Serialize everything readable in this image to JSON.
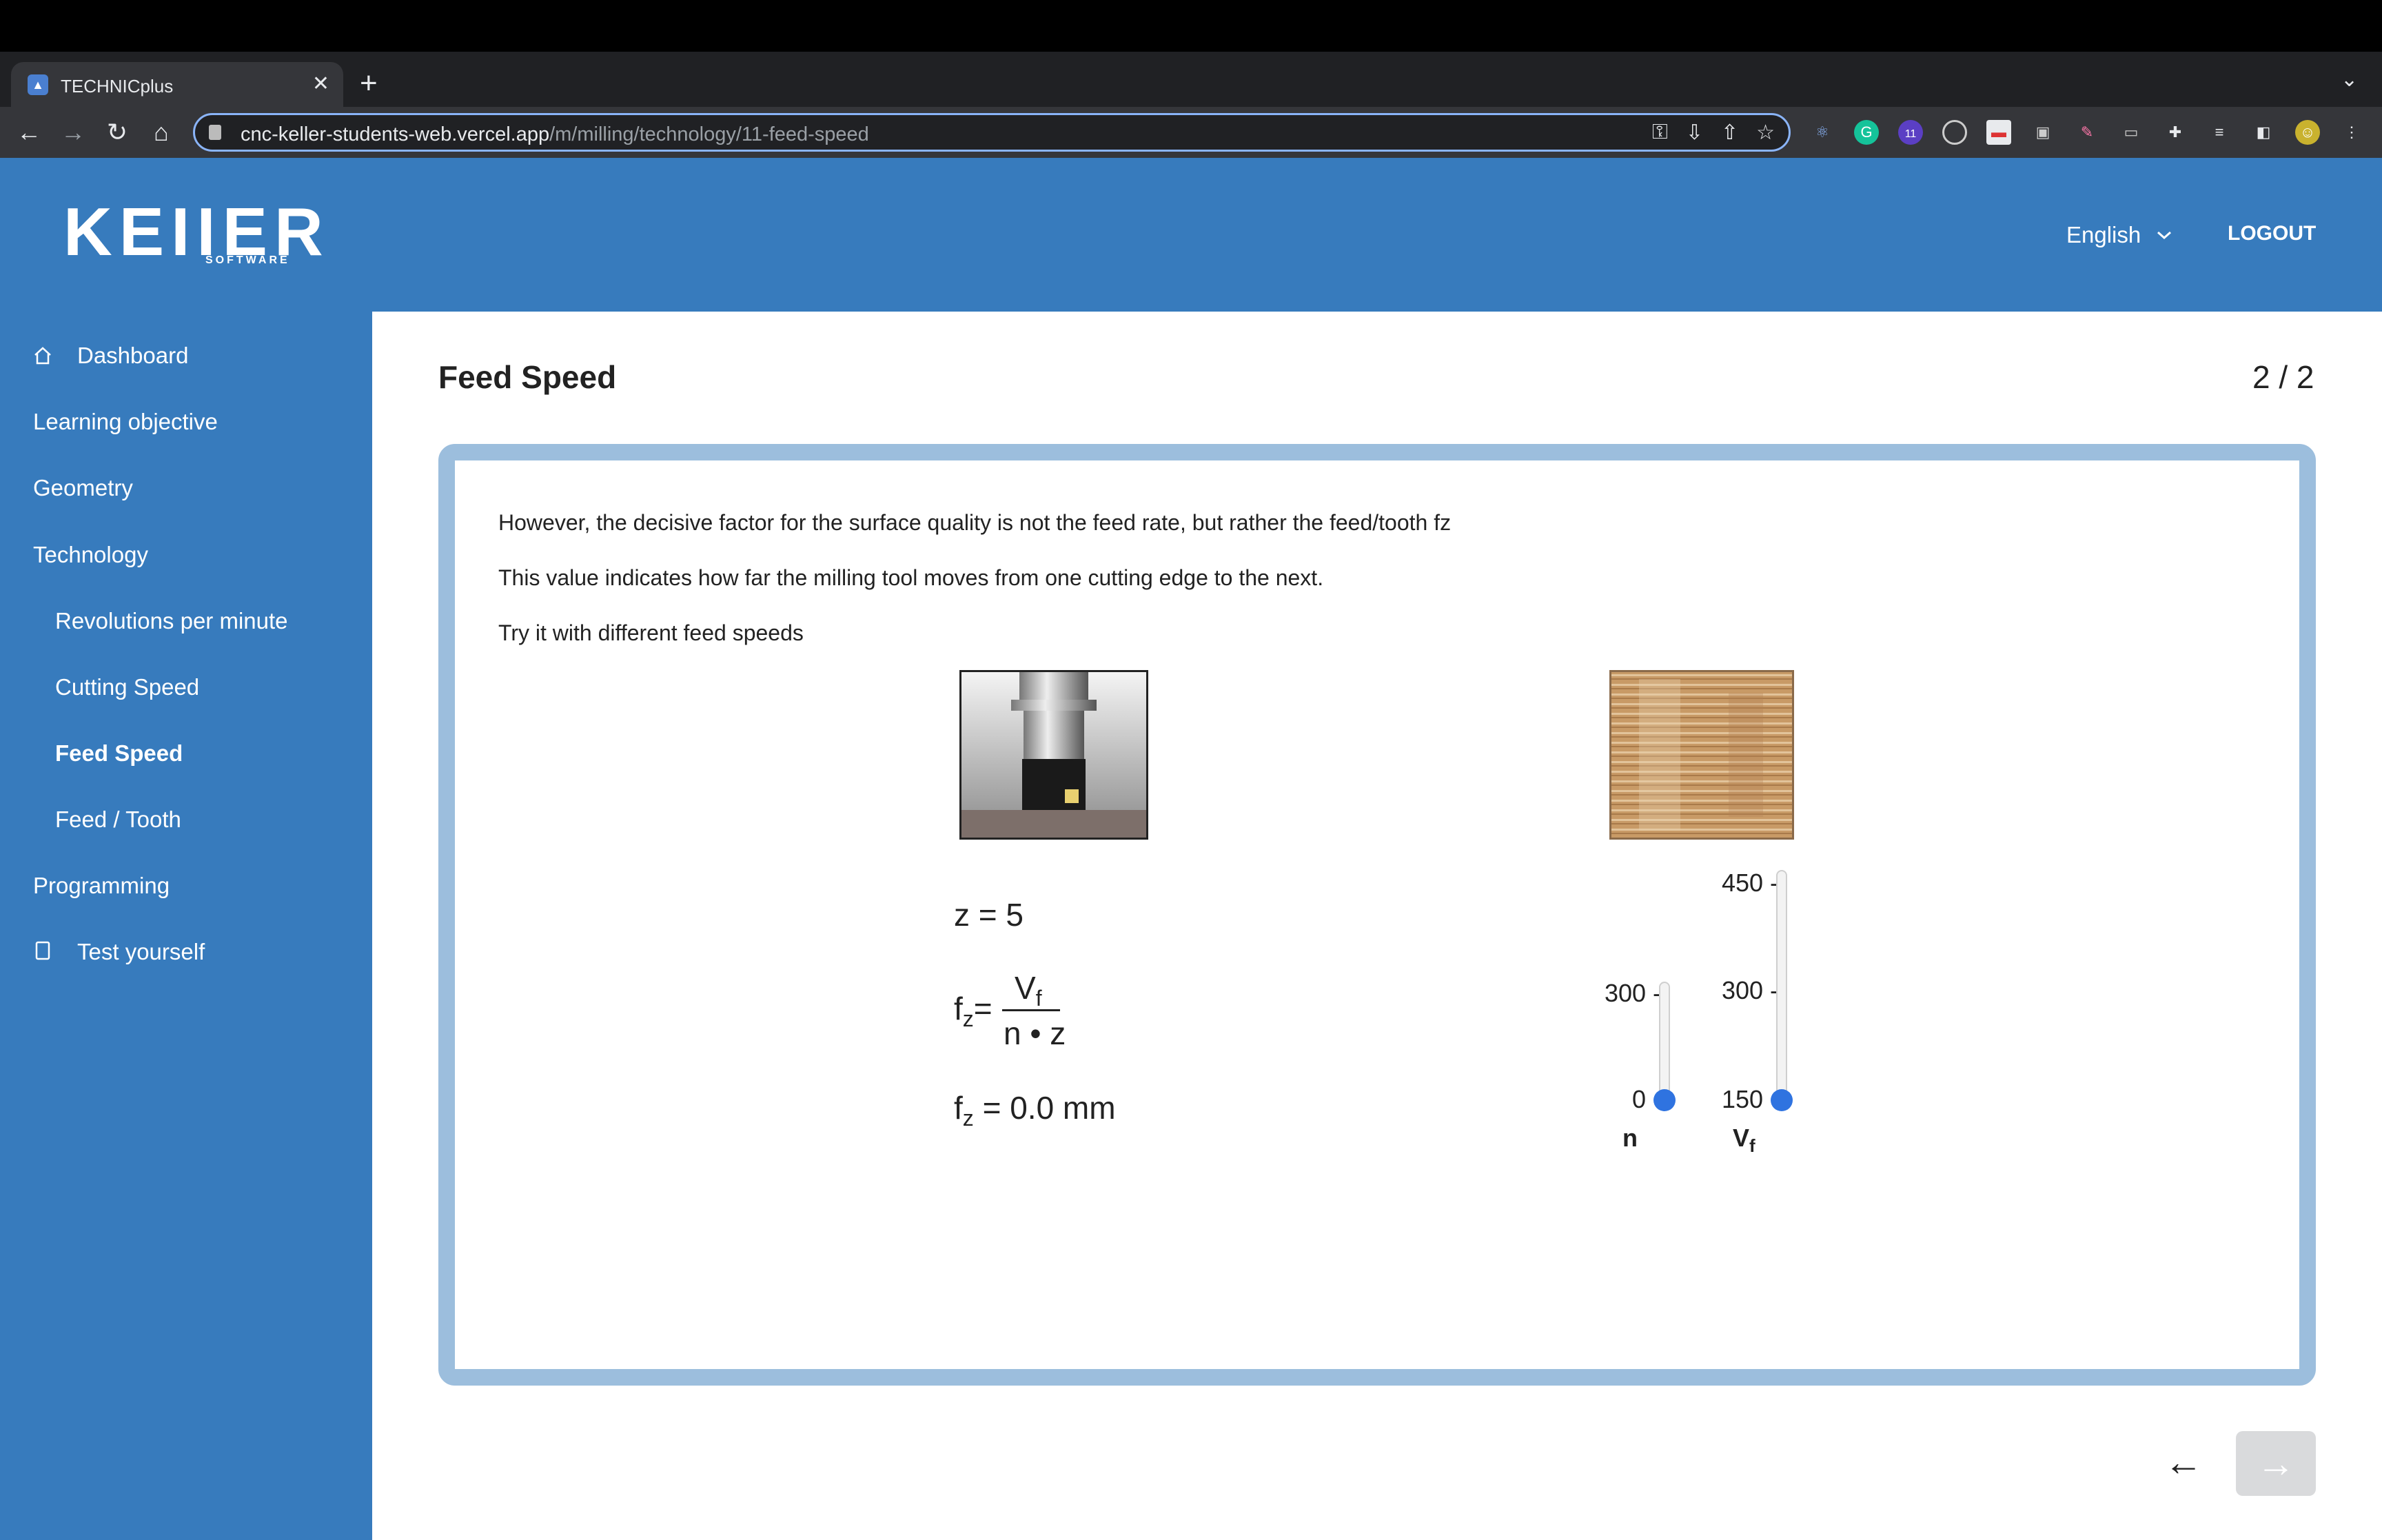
{
  "browser": {
    "tab_title": "TECHNICplus",
    "tab_close": "✕",
    "new_tab": "+",
    "tab_dropdown": "⌄",
    "url_host": "cnc-keller-students-web.vercel.app",
    "url_path": "/m/milling/technology/11-feed-speed",
    "extension_badge": "11"
  },
  "header": {
    "logo": "KEIIER",
    "logo_sub": "SOFTWARE",
    "language": "English",
    "logout": "LOGOUT"
  },
  "sidebar": {
    "items": [
      {
        "label": "Dashboard"
      },
      {
        "label": "Learning objective"
      },
      {
        "label": "Geometry"
      },
      {
        "label": "Technology"
      },
      {
        "label": "Revolutions per minute"
      },
      {
        "label": "Cutting Speed"
      },
      {
        "label": "Feed Speed"
      },
      {
        "label": "Feed / Tooth"
      },
      {
        "label": "Programming"
      },
      {
        "label": "Test yourself"
      }
    ]
  },
  "main": {
    "title": "Feed Speed",
    "pager": "2 / 2",
    "paragraphs": [
      "However, the decisive factor for the surface quality is not the feed rate, but rather the feed/tooth fz",
      "This value indicates how far the milling tool moves from one cutting edge to the next.",
      "Try it with different feed speeds"
    ],
    "formula": {
      "z_line": "z = 5",
      "fz_symbol": "f",
      "fz_sub": "z",
      "equals": "=",
      "numerator": "V",
      "numerator_sub": "f",
      "denominator": "n • z",
      "result_value": "= 0.0 mm"
    },
    "sliders": {
      "n": {
        "label": "n",
        "ticks": [
          "300 -",
          "0 -"
        ],
        "value": 0,
        "min": 0,
        "max": 300
      },
      "vf": {
        "label": "V",
        "label_sub": "f",
        "ticks": [
          "450 -",
          "300 -",
          "150 -"
        ],
        "value": 150,
        "min": 150,
        "max": 450
      }
    }
  },
  "footer_nav": {
    "back": "←",
    "next": "→"
  },
  "colors": {
    "brand_blue": "#377bbd",
    "card_border": "#9cbedd",
    "slider_thumb": "#2f73e0"
  }
}
